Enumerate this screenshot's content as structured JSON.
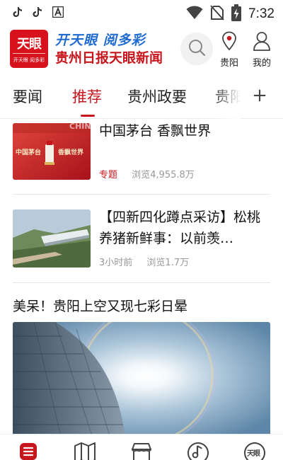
{
  "status_bar": {
    "time": "7:32",
    "icons": [
      "tiktok-icon",
      "tiktok-icon",
      "font-icon",
      "wifi-icon",
      "no-sim-icon",
      "battery-charging-icon"
    ]
  },
  "header": {
    "logo_text": "天眼",
    "logo_subtext": "开天眼 阅多彩",
    "slogan": "开天眼 阅多彩",
    "paper_name": "贵州日报天眼新闻",
    "location_label": "贵阳",
    "profile_label": "我的"
  },
  "tabs": {
    "items": [
      {
        "label": "要闻"
      },
      {
        "label": "推荐"
      },
      {
        "label": "贵州政要"
      },
      {
        "label": "贵阳"
      }
    ],
    "active_index": 1,
    "add_label": "+"
  },
  "feed": {
    "articles": [
      {
        "title": "中国茅台  香飘世界",
        "tag": "专题",
        "views": "浏览4,955.8万",
        "thumb_text_1": "中国茅台",
        "thumb_text_2": "香飘世界",
        "thumb_top_text": "CHIN"
      },
      {
        "title": "【四新四化蹲点采访】松桃养猪新鲜事：以前羡…",
        "time": "3小时前",
        "views": "浏览1.7万"
      }
    ],
    "featured": {
      "title": "美呆！贵阳上空又现七彩日晕"
    }
  },
  "bottom_nav": {
    "items": [
      {
        "icon": "news-list-icon",
        "active": true
      },
      {
        "icon": "map-icon"
      },
      {
        "icon": "store-icon"
      },
      {
        "icon": "music-note-icon"
      },
      {
        "icon": "tianyan-logo-icon"
      }
    ],
    "tianyan_text": "天眼"
  },
  "colors": {
    "brand_red": "#c8161d",
    "slogan_blue": "#1f6bd1"
  }
}
